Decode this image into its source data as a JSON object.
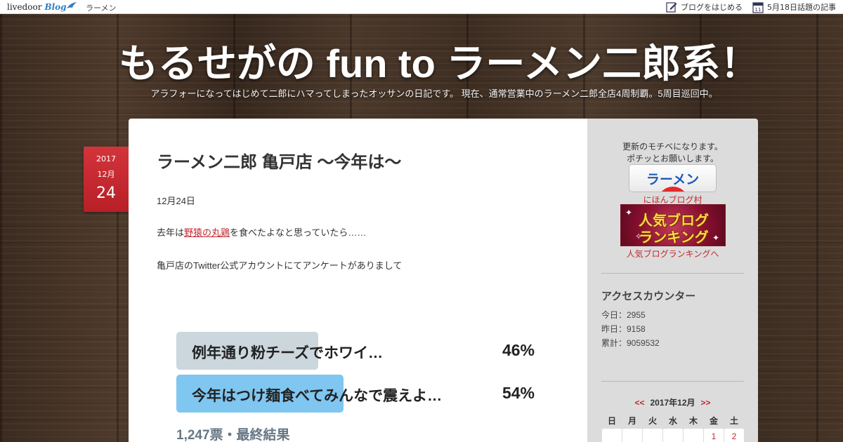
{
  "topbar": {
    "logo_text": "livedoor",
    "logo_blog": "Blog",
    "category": "ラーメン",
    "start_blog": "ブログをはじめる",
    "calendar_day": "11",
    "topic_articles": "5月18日話題の記事"
  },
  "header": {
    "title": "もるせがの fun to ラーメン二郎系！",
    "description": "アラフォーになってはじめて二郎にハマってしまったオッサンの日記です。 現在、通常営業中のラーメン二郎全店4周制覇。5周目巡回中。"
  },
  "date_badge": {
    "year": "2017",
    "month": "12月",
    "day": "24"
  },
  "article": {
    "title": "ラーメン二郎 亀戸店 〜今年は〜",
    "date_line": "12月24日",
    "p2_before": "去年は",
    "p2_link": "野猿の丸鶏",
    "p2_after": "を食べたよなと思っていたら……",
    "p3": "亀戸店のTwitter公式アカウントにてアンケートがありまして",
    "poll": {
      "options": [
        {
          "label": "例年通り粉チーズでホワイ…",
          "percent": "46%",
          "fill": 0.46,
          "color": "#ccd6dd"
        },
        {
          "label": "今年はつけ麺食べてみんなで震えよ…",
          "percent": "54%",
          "fill": 0.54,
          "color": "#7fc6f0"
        }
      ],
      "votes": "1,247票・最終結果"
    }
  },
  "sidebar": {
    "motive_line1": "更新のモチベになります。",
    "motive_line2": "ポチッとお願いします。",
    "ramen_button": "ラーメン",
    "nihon_link": "にほんブログ村",
    "rank_line1": "人気ブログ",
    "rank_line2": "ランキング",
    "rank_link": "人気ブログランキングへ",
    "counter_title": "アクセスカウンター",
    "today": "今日：2955",
    "yesterday": "昨日：9158",
    "total": "累計：9059532",
    "calendar": {
      "prev": "<<",
      "month": "2017年12月",
      "next": ">>",
      "weekdays": [
        "日",
        "月",
        "火",
        "水",
        "木",
        "金",
        "土"
      ],
      "first_row": [
        "",
        "",
        "",
        "",
        "",
        "1",
        "2"
      ]
    }
  },
  "colors": {
    "accent_red": "#c1272d",
    "badge_red": "#c8262e",
    "ramen_blue": "#1e5bb8"
  }
}
